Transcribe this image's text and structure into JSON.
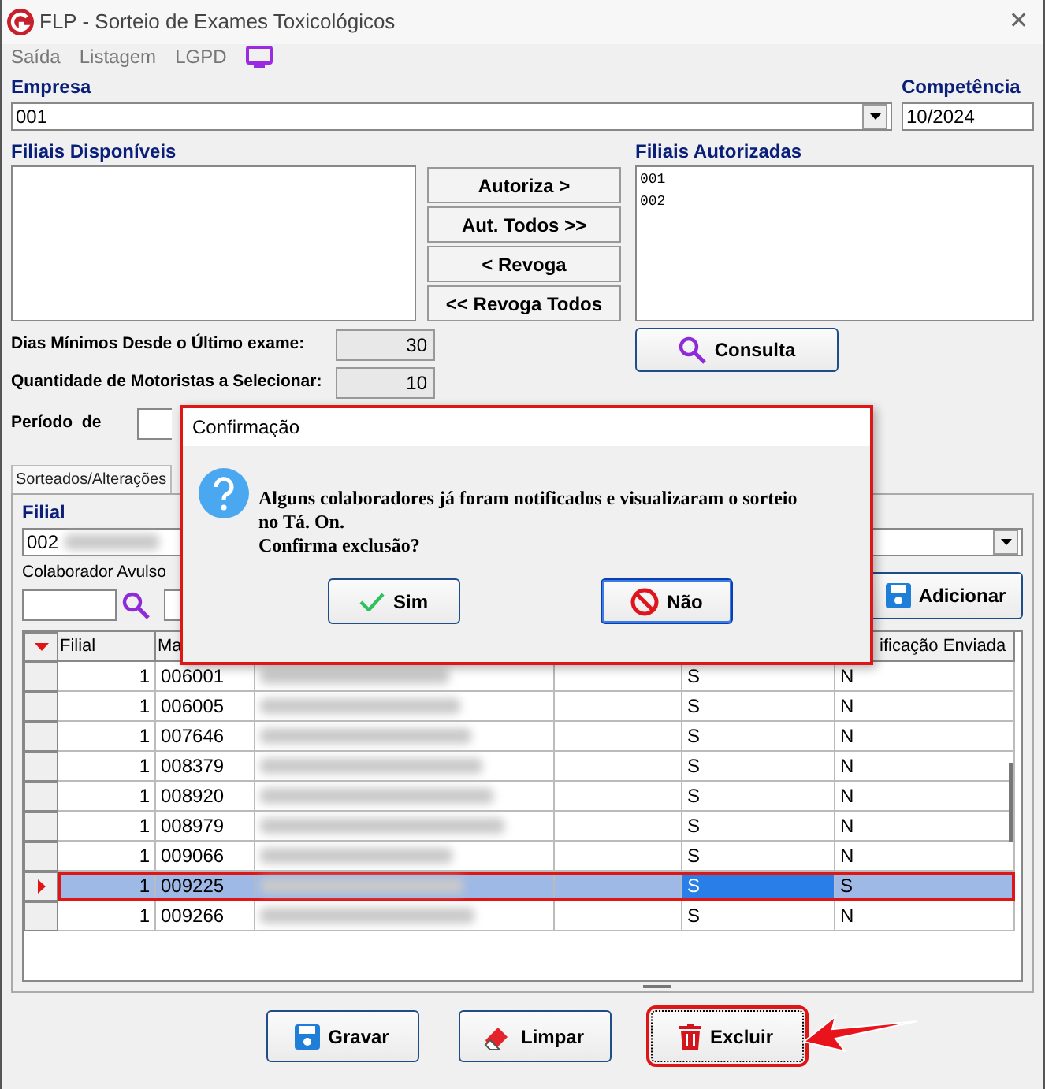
{
  "window": {
    "title": "FLP - Sorteio de Exames Toxicológicos",
    "close": "✕"
  },
  "menu": [
    "Saída",
    "Listagem",
    "LGPD"
  ],
  "empresa": {
    "label": "Empresa",
    "value": "001"
  },
  "competencia": {
    "label": "Competência",
    "value": "10/2024"
  },
  "filiais_disponiveis": {
    "label": "Filiais Disponíveis"
  },
  "transfer_buttons": [
    "Autoriza >",
    "Aut. Todos >>",
    "< Revoga",
    "<< Revoga Todos"
  ],
  "filiais_autorizadas": {
    "label": "Filiais Autorizadas",
    "items": [
      "001",
      "002"
    ]
  },
  "consulta_button": "Consulta",
  "params": [
    {
      "label": "Dias Mínimos Desde o Último exame:",
      "value": "30"
    },
    {
      "label": "Quantidade de Motoristas a Selecionar:",
      "value": "10"
    }
  ],
  "periodo": {
    "label": "Período  de"
  },
  "tabs": [
    {
      "label": "Sorteados/Alterações",
      "selected": true
    }
  ],
  "filial": {
    "label": "Filial",
    "value": "002"
  },
  "colaborador_avulso": {
    "label": "Colaborador Avulso"
  },
  "add_button": "Adicionar",
  "table": {
    "columns": [
      {
        "label": "Filial"
      },
      {
        "label": "Ma"
      },
      {
        "label": "ificação Enviada"
      }
    ],
    "rows": [
      {
        "filial": "1",
        "column_2": "006001",
        "column_6": "S",
        "column_7": "N",
        "selected": false
      },
      {
        "filial": "1",
        "column_2": "006005",
        "column_6": "S",
        "column_7": "N",
        "selected": false
      },
      {
        "filial": "1",
        "column_2": "007646",
        "column_6": "S",
        "column_7": "N",
        "selected": false
      },
      {
        "filial": "1",
        "column_2": "008379",
        "column_6": "S",
        "column_7": "N",
        "selected": false
      },
      {
        "filial": "1",
        "column_2": "008920",
        "column_6": "S",
        "column_7": "N",
        "selected": false
      },
      {
        "filial": "1",
        "column_2": "008979",
        "column_6": "S",
        "column_7": "N",
        "selected": false
      },
      {
        "filial": "1",
        "column_2": "009066",
        "column_6": "S",
        "column_7": "N",
        "selected": false
      },
      {
        "filial": "1",
        "column_2": "009225",
        "column_6": "S",
        "column_7": "S",
        "selected": true
      },
      {
        "filial": "1",
        "column_2": "009266",
        "column_6": "S",
        "column_7": "N",
        "selected": false
      }
    ]
  },
  "footer_buttons": [
    {
      "kind": "save",
      "label": "Gravar",
      "highlighted": false
    },
    {
      "kind": "clear",
      "label": "Limpar",
      "highlighted": false
    },
    {
      "kind": "delete",
      "label": "Excluir",
      "highlighted": true
    }
  ],
  "dialog": {
    "title": "Confirmação",
    "message": "Alguns colaboradores já foram notificados e visualizaram o sorteio no Tá. On.",
    "question": "Confirma exclusão?",
    "buttons": [
      {
        "kind": "yes",
        "label": "Sim",
        "focused": false
      },
      {
        "kind": "no",
        "label": "Não",
        "focused": true
      }
    ]
  }
}
